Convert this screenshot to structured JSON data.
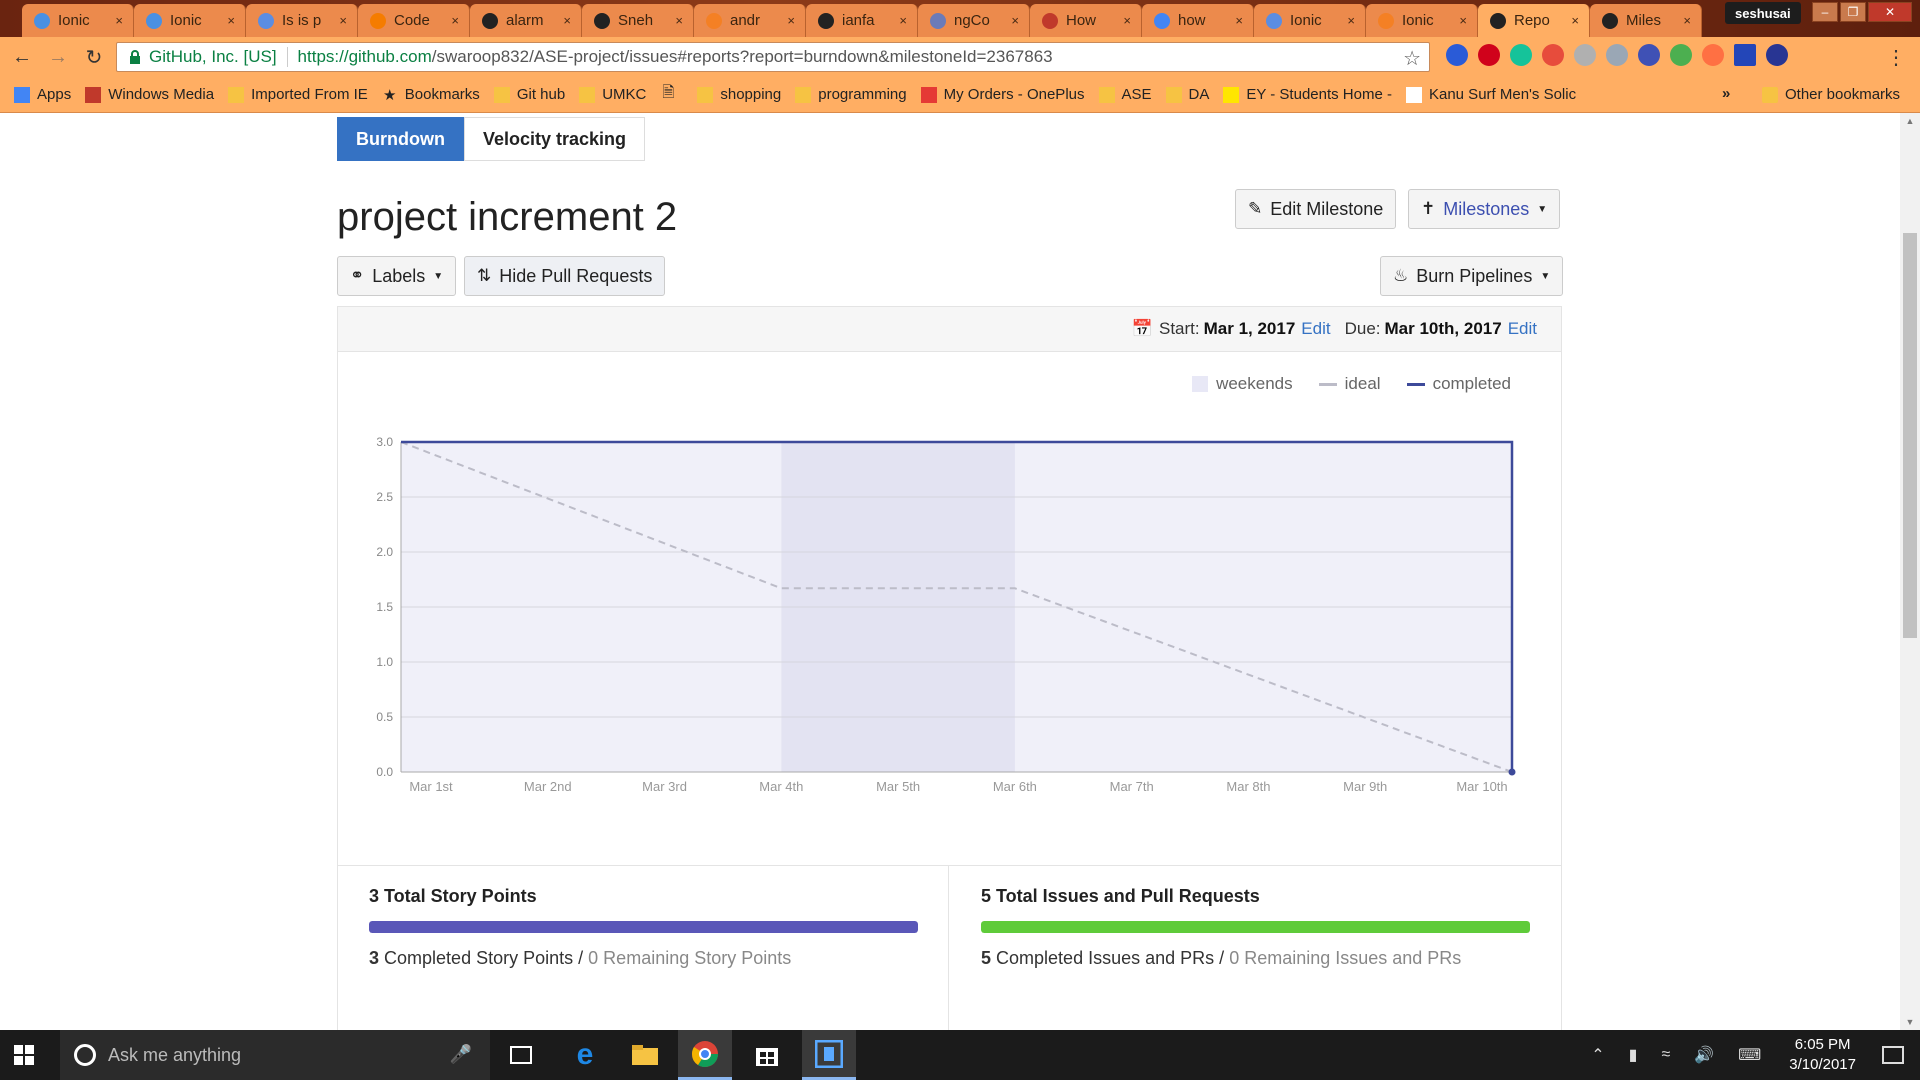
{
  "browser": {
    "tabs": [
      {
        "label": "Ionic",
        "color": "#4a90e2"
      },
      {
        "label": "Ionic",
        "color": "#4a90e2"
      },
      {
        "label": "Is is p",
        "color": "#5b8de2"
      },
      {
        "label": "Code",
        "color": "#f57c00"
      },
      {
        "label": "alarm",
        "color": "#222222"
      },
      {
        "label": "Sneh",
        "color": "#222222"
      },
      {
        "label": "andr",
        "color": "#f48024"
      },
      {
        "label": "ianfa",
        "color": "#222222"
      },
      {
        "label": "ngCo",
        "color": "#6b7bb8"
      },
      {
        "label": "How",
        "color": "#c0392b"
      },
      {
        "label": "how",
        "color": "#4285f4"
      },
      {
        "label": "Ionic",
        "color": "#5b8de2"
      },
      {
        "label": "Ionic",
        "color": "#f48024"
      },
      {
        "label": "Repo",
        "color": "#222222"
      },
      {
        "label": "Miles",
        "color": "#222222"
      }
    ],
    "close_glyph": "×",
    "profile_name": "seshusai",
    "omnibox": {
      "secure_label": "GitHub, Inc. [US]",
      "url_host": "https://github.com",
      "url_rest": "/swaroop832/ASE-project/issues#reports?report=burndown&milestoneId=2367863"
    },
    "bookmarks": [
      {
        "label": "Apps",
        "icon": "apps-icon"
      },
      {
        "label": "Windows Media",
        "icon": "windows-media-icon"
      },
      {
        "label": "Imported From IE",
        "icon": "folder-icon"
      },
      {
        "label": "Bookmarks",
        "icon": "star-icon"
      },
      {
        "label": "Git hub",
        "icon": "folder-icon"
      },
      {
        "label": "UMKC",
        "icon": "folder-icon"
      },
      {
        "label": "",
        "icon": "page-icon"
      },
      {
        "label": "shopping",
        "icon": "folder-icon"
      },
      {
        "label": "programming",
        "icon": "folder-icon"
      },
      {
        "label": "My Orders - OnePlus",
        "icon": "oneplus-icon"
      },
      {
        "label": "ASE",
        "icon": "folder-icon"
      },
      {
        "label": "DA",
        "icon": "folder-icon"
      },
      {
        "label": "EY - Students Home -",
        "icon": "ey-icon"
      },
      {
        "label": "Kanu Surf Men's Solic",
        "icon": "amazon-icon"
      }
    ],
    "bookmarks_more": "»",
    "other_bookmarks": "Other bookmarks"
  },
  "report": {
    "tabs": [
      "Burndown",
      "Velocity tracking"
    ],
    "milestone_title": "project increment 2",
    "edit_milestone": "Edit Milestone",
    "milestones": "Milestones",
    "labels": "Labels",
    "hide_prs": "Hide Pull Requests",
    "burn_pipelines": "Burn Pipelines",
    "start_label": "Start:",
    "start_date": "Mar 1, 2017",
    "due_label": "Due:",
    "due_date": "Mar 10th, 2017",
    "edit_link": "Edit",
    "legend": {
      "weekends": "weekends",
      "ideal": "ideal",
      "completed": "completed"
    }
  },
  "chart_data": {
    "type": "line",
    "title": "",
    "xlabel": "",
    "ylabel": "",
    "categories": [
      "Mar 1st",
      "Mar 2nd",
      "Mar 3rd",
      "Mar 4th",
      "Mar 5th",
      "Mar 6th",
      "Mar 7th",
      "Mar 8th",
      "Mar 9th",
      "Mar 10th"
    ],
    "ylim": [
      0,
      3
    ],
    "yticks": [
      "0.0",
      "0.5",
      "1.0",
      "1.5",
      "2.0",
      "2.5",
      "3.0"
    ],
    "weekend_range": [
      "Mar 4th",
      "Mar 6th"
    ],
    "series": [
      {
        "name": "ideal",
        "style": "dashed",
        "color": "#bcbcc8",
        "points": [
          [
            0,
            3.0
          ],
          [
            3,
            1.67
          ],
          [
            5,
            1.67
          ],
          [
            9,
            0.0
          ]
        ]
      },
      {
        "name": "completed",
        "style": "solid",
        "color": "#3d4a9a",
        "points": [
          [
            0,
            3.0
          ],
          [
            9,
            3.0
          ],
          [
            9,
            0.0
          ]
        ]
      }
    ],
    "grid": true,
    "legend_position": "top-right"
  },
  "summary": {
    "points_title": "3 Total Story Points",
    "points_completed": "3",
    "points_completed_label": "Completed Story Points",
    "points_remaining": "0 Remaining Story Points",
    "points_fraction": 1.0,
    "points_color": "#5a57b8",
    "issues_title": "5 Total Issues and Pull Requests",
    "issues_completed": "5",
    "issues_completed_label": "Completed Issues and PRs",
    "issues_remaining": "0 Remaining Issues and PRs",
    "issues_fraction": 1.0,
    "issues_color": "#5fcb3a",
    "separator": "/"
  },
  "taskbar": {
    "search_placeholder": "Ask me anything",
    "time": "6:05 PM",
    "date": "3/10/2017"
  }
}
